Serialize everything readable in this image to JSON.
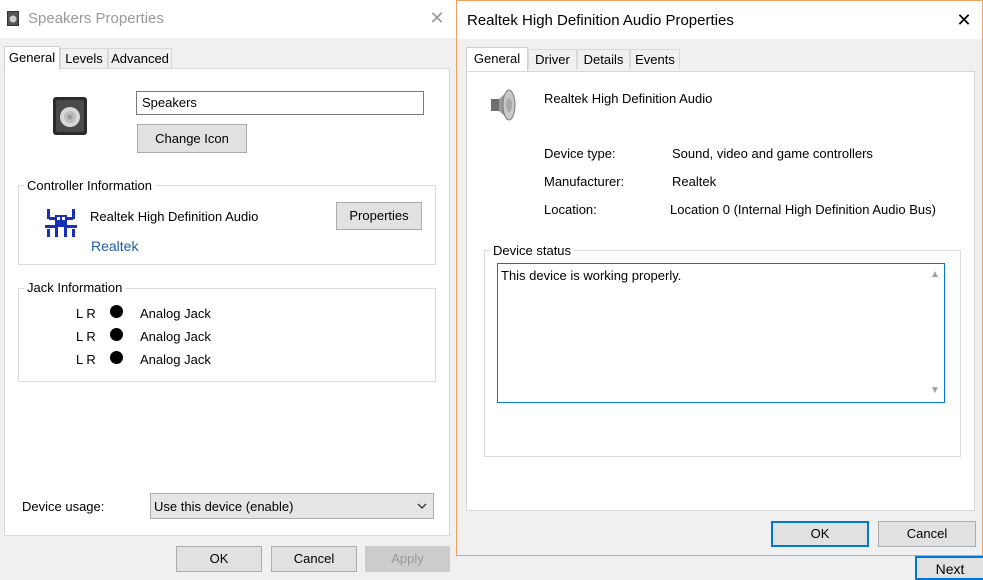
{
  "left_window": {
    "title": "Speakers Properties",
    "tabs": [
      {
        "label": "General",
        "active": true
      },
      {
        "label": "Levels",
        "active": false
      },
      {
        "label": "Advanced",
        "active": false
      }
    ],
    "name_field": "Speakers",
    "change_icon_label": "Change Icon",
    "controller_group_label": "Controller Information",
    "controller_name": "Realtek High Definition Audio",
    "controller_vendor": "Realtek",
    "properties_label": "Properties",
    "jack_group_label": "Jack Information",
    "jacks": [
      {
        "channels": "L R",
        "label": "Analog Jack"
      },
      {
        "channels": "L R",
        "label": "Analog Jack"
      },
      {
        "channels": "L R",
        "label": "Analog Jack"
      }
    ],
    "device_usage_label": "Device usage:",
    "device_usage_value": "Use this device (enable)",
    "buttons": {
      "ok": "OK",
      "cancel": "Cancel",
      "apply": "Apply"
    }
  },
  "right_window": {
    "title": "Realtek High Definition Audio Properties",
    "tabs": [
      {
        "label": "General",
        "active": true
      },
      {
        "label": "Driver",
        "active": false
      },
      {
        "label": "Details",
        "active": false
      },
      {
        "label": "Events",
        "active": false
      }
    ],
    "device_name": "Realtek High Definition Audio",
    "properties": [
      {
        "label": "Device type:",
        "value": "Sound, video and game controllers"
      },
      {
        "label": "Manufacturer:",
        "value": "Realtek"
      },
      {
        "label": "Location:",
        "value": "Location 0 (Internal High Definition Audio Bus)"
      }
    ],
    "status_group_label": "Device status",
    "status_text": "This device is working properly.",
    "buttons": {
      "ok": "OK",
      "cancel": "Cancel"
    }
  },
  "background": {
    "next_label": "Next"
  },
  "colors": {
    "accent": "#0078d7",
    "link_blue": "#1f5fa6",
    "active_border": "#f0a05a"
  }
}
